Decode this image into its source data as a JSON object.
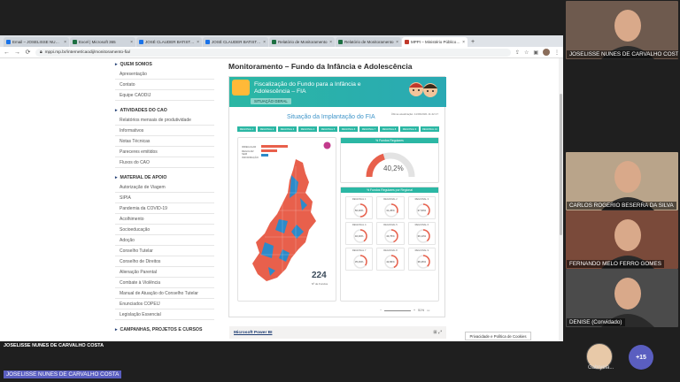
{
  "browser": {
    "tabs": [
      {
        "label": "Email – JOSELISSE NUNES DE C",
        "color": "#1a73e8"
      },
      {
        "label": "Excel | Microsoft 365",
        "color": "#1d6f42"
      },
      {
        "label": "JOSÉ CLAUDER BATISTA ALCÂ",
        "color": "#1a73e8"
      },
      {
        "label": "JOSÉ CLAUDER BATISTA ALCÂ",
        "color": "#1a73e8"
      },
      {
        "label": "Relatório de Monitoramento",
        "color": "#1d6f42"
      },
      {
        "label": "Relatório de Monitoramento",
        "color": "#1d6f42"
      },
      {
        "label": "MPPI – Ministério Público do E",
        "color": "#c0392b"
      }
    ],
    "url": "mppi.mp.br/internet/caodij/monitoramento-fia/"
  },
  "sidebar": {
    "sections": [
      {
        "title": "QUEM SOMOS",
        "items": [
          "Apresentação",
          "Contato",
          "Equipe CAODIJ"
        ]
      },
      {
        "title": "ATIVIDADES DO CAO",
        "items": [
          "Relatórios mensais de produtividade",
          "Informativos",
          "Notas Técnicas",
          "Pareceres emitidos",
          "Fluxos do CAO"
        ]
      },
      {
        "title": "MATERIAL DE APOIO",
        "items": [
          "Autorização de Viagem",
          "SIPIA",
          "Pandemia da COVID-19",
          "Acolhimento",
          "Socioeducação",
          "Adoção",
          "Conselho Tutelar",
          "Conselho de Direitos",
          "Alienação Parental",
          "Combate à Violência",
          "Manual de Atuação do Conselho Tutelar",
          "Enunciados COPEIJ",
          "Legislação Essencial"
        ]
      },
      {
        "title": "CAMPANHAS, PROJETOS E CURSOS",
        "items": []
      }
    ]
  },
  "main": {
    "title": "Monitoramento – Fundo da Infância e Adolescência"
  },
  "pbi": {
    "header_title": "Fiscalização do Fundo para a Infância e Adolescência – FIA",
    "pill": "SITUAÇÃO GERAL",
    "report_title": "Situação da Implantação do FIA",
    "updated": "Última atualização: 11/03/2021 11:42:17",
    "regions": [
      "REGIONAL 1",
      "REGIONAL 2",
      "REGIONAL 3",
      "REGIONAL 4",
      "REGIONAL 5",
      "REGIONAL 6",
      "REGIONAL 7",
      "REGIONAL 8",
      "REGIONAL 9",
      "REGIONAL 10"
    ],
    "legend": [
      {
        "label": "IRREGULAR",
        "color": "#e8604c",
        "value": 0.75
      },
      {
        "label": "REGULAR",
        "color": "#e8604c",
        "value": 0.45
      },
      {
        "label": "SEM INFORMAÇÃO",
        "color": "#2d8ac9",
        "value": 0.2
      }
    ],
    "gauge_header": "% Fundos Regulares",
    "gauge_value": "40,2%",
    "gauge_fraction": 0.402,
    "reg_header": "% Fundos Regulares por Regional",
    "mini": [
      {
        "label": "REGIONAL 1",
        "value": "50,00%",
        "frac": 0.5
      },
      {
        "label": "REGIONAL 2",
        "value": "31,25%",
        "frac": 0.31
      },
      {
        "label": "REGIONAL 3",
        "value": "37,50%",
        "frac": 0.37
      },
      {
        "label": "REGIONAL 4",
        "value": "40,00%",
        "frac": 0.4
      },
      {
        "label": "REGIONAL 5",
        "value": "43,75%",
        "frac": 0.44
      },
      {
        "label": "REGIONAL 6",
        "value": "39,13%",
        "frac": 0.39
      },
      {
        "label": "REGIONAL 7",
        "value": "35,29%",
        "frac": 0.35
      },
      {
        "label": "REGIONAL 8",
        "value": "42,86%",
        "frac": 0.43
      },
      {
        "label": "REGIONAL 9",
        "value": "38,46%",
        "frac": 0.38
      }
    ],
    "count": "224",
    "count_label": "Nº de Fundos",
    "zoom": "51%",
    "footer_link": "Microsoft Power BI"
  },
  "privacy": "Privacidade e Política de Cookies",
  "presenter": "JOSELISSE NUNES DE CARVALHO COSTA",
  "bottom_name": "JOSELISSE NUNES DE CARVALHO COSTA",
  "participants": [
    {
      "name": "JOSELISSE NUNES DE CARVALHO COSTA",
      "bg": "#6e5a4e"
    },
    {
      "name": "CARLOS ROGERIO BESERRA DA SILVA",
      "bg": "#b9a48a"
    },
    {
      "name": "FERNANDO MELO FERRO GOMES",
      "bg": "#7a4a3a"
    },
    {
      "name": "DENISE (Convidado)",
      "bg": "#4b4b4b"
    }
  ],
  "gabryela": "Gabryela...",
  "more_count": "+15"
}
